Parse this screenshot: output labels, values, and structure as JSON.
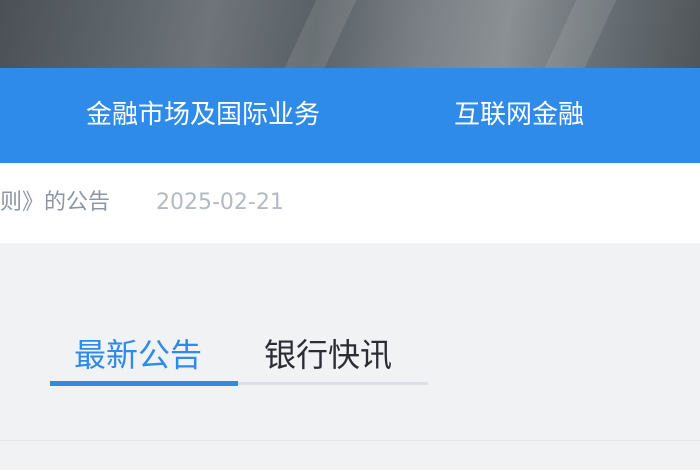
{
  "nav": {
    "items": [
      {
        "label": "金融市场及国际业务"
      },
      {
        "label": "互联网金融"
      }
    ]
  },
  "notice": {
    "title": "则》的公告",
    "date": "2025-02-21"
  },
  "tabs": {
    "items": [
      {
        "label": "最新公告",
        "active": true
      },
      {
        "label": "银行快讯",
        "active": false
      }
    ]
  },
  "colors": {
    "accent": "#2e8bea",
    "nav_background": "#2e8bea",
    "nav_text": "#ffffff",
    "notice_text": "#8c96a6",
    "date_text": "#b4bac2",
    "tab_inactive_text": "#2a2d33",
    "page_background": "#f1f2f4"
  }
}
